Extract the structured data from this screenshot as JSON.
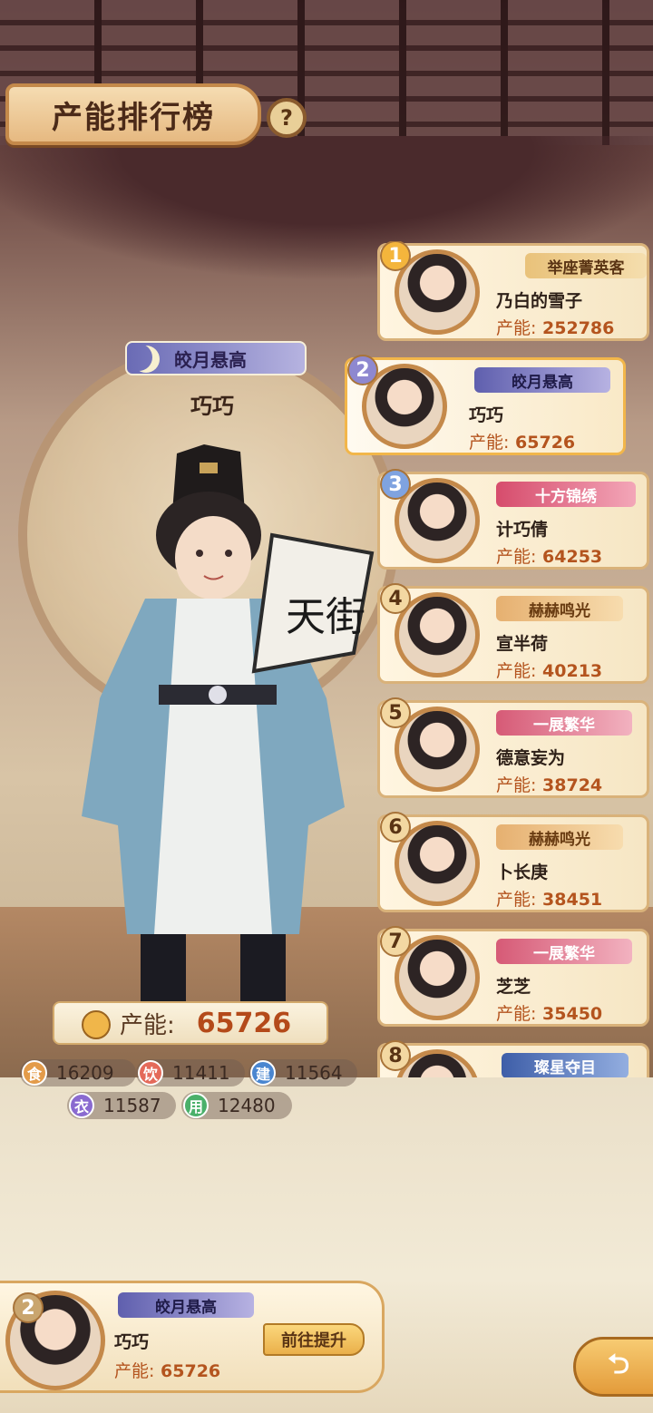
{
  "title": "产能排行榜",
  "help_icon": "?",
  "hero": {
    "title_badge": "皎月悬高",
    "name": "巧巧",
    "production_label": "产能:",
    "production_value": "65726",
    "stats": [
      {
        "icon": "食",
        "value": "16209",
        "color": "#e39b4a"
      },
      {
        "icon": "饮",
        "value": "11411",
        "color": "#e46a5a"
      },
      {
        "icon": "建",
        "value": "11564",
        "color": "#4a86d0"
      },
      {
        "icon": "衣",
        "value": "11587",
        "color": "#8a6ad0"
      },
      {
        "icon": "用",
        "value": "12480",
        "color": "#4ab06a"
      }
    ]
  },
  "ranking": [
    {
      "rank": "1",
      "badge": "举座菁英客",
      "name": "乃白的雪子",
      "prod_label": "产能:",
      "prod": "252786"
    },
    {
      "rank": "2",
      "badge": "皎月悬高",
      "name": "巧巧",
      "prod_label": "产能:",
      "prod": "65726"
    },
    {
      "rank": "3",
      "badge": "十方锦绣",
      "name": "计巧倩",
      "prod_label": "产能:",
      "prod": "64253"
    },
    {
      "rank": "4",
      "badge": "赫赫鸣光",
      "name": "宣半荷",
      "prod_label": "产能:",
      "prod": "40213"
    },
    {
      "rank": "5",
      "badge": "一展繁华",
      "name": "德意妄为",
      "prod_label": "产能:",
      "prod": "38724"
    },
    {
      "rank": "6",
      "badge": "赫赫鸣光",
      "name": "卜长庚",
      "prod_label": "产能:",
      "prod": "38451"
    },
    {
      "rank": "7",
      "badge": "一展繁华",
      "name": "芝芝",
      "prod_label": "产能:",
      "prod": "35450"
    },
    {
      "rank": "8",
      "badge": "璨星夺目",
      "name": "",
      "prod_label": "",
      "prod": ""
    }
  ],
  "me": {
    "rank": "2",
    "badge": "皎月悬高",
    "name": "巧巧",
    "prod_label": "产能:",
    "prod": "65726",
    "go_button": "前往提升"
  },
  "back_icon": "⮌"
}
